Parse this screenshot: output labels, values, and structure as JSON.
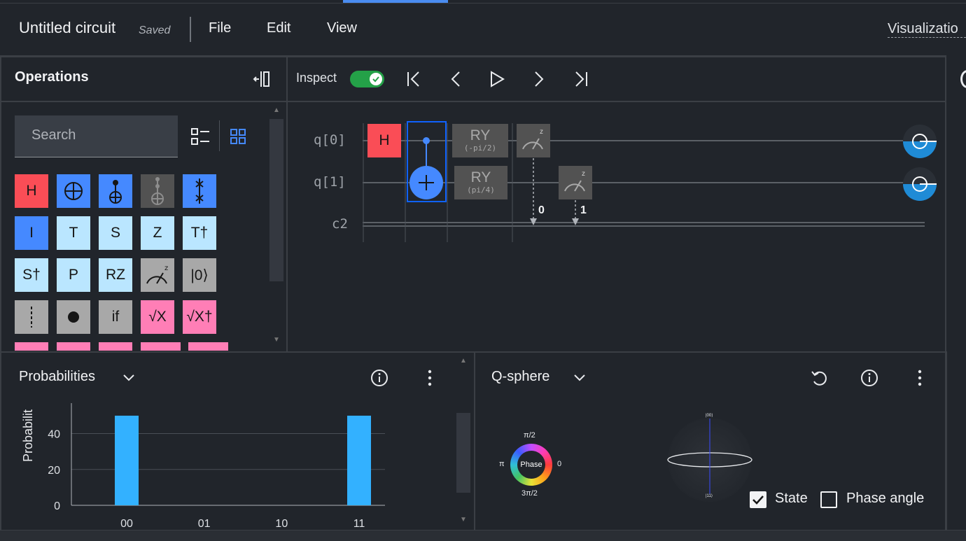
{
  "header": {
    "circuit_title": "Untitled circuit",
    "save_status": "Saved",
    "menu": [
      "File",
      "Edit",
      "View"
    ],
    "visualization_link": "Visualizatio"
  },
  "operations": {
    "title": "Operations",
    "search_placeholder": "Search",
    "gates_row1": [
      "H",
      "CNOT",
      "CCX-control",
      "Toffoli",
      "SWAP"
    ],
    "gates_row2": [
      "I",
      "T",
      "S",
      "Z",
      "T†"
    ],
    "gates_row3": [
      "S†",
      "P",
      "RZ",
      "Measure",
      "|0⟩"
    ],
    "gates_row4": [
      "Barrier",
      "Control",
      "if",
      "√X",
      "√X†"
    ]
  },
  "inspect": {
    "label": "Inspect",
    "enabled": true
  },
  "circuit": {
    "qubits": [
      "q[0]",
      "q[1]"
    ],
    "classical": "c2",
    "gate_h": "H",
    "ry1_label": "RY",
    "ry1_param": "(-pi/2)",
    "ry2_label": "RY",
    "ry2_param": "(pi/4)",
    "measure_basis": "z",
    "measure_bits": [
      "0",
      "1"
    ]
  },
  "probabilities": {
    "title": "Probabilities",
    "ylabel": "Probabilit",
    "accent_color": "#33b1ff"
  },
  "chart_data": {
    "type": "bar",
    "categories": [
      "00",
      "01",
      "10",
      "11"
    ],
    "values": [
      50,
      0,
      0,
      50
    ],
    "ylabel": "Probabilit",
    "yticks": [
      0,
      20,
      40
    ],
    "ylim": [
      0,
      57
    ],
    "grid": true
  },
  "qsphere": {
    "title": "Q-sphere",
    "phase_label": "Phase",
    "phase_top": "π/2",
    "phase_left": "π",
    "phase_right": "0",
    "phase_bottom": "3π/2",
    "state_top": "|00⟩",
    "state_bottom": "|11⟩",
    "state_checkbox": "State",
    "state_checked": true,
    "phase_angle_checkbox": "Phase angle",
    "phase_angle_checked": false
  }
}
